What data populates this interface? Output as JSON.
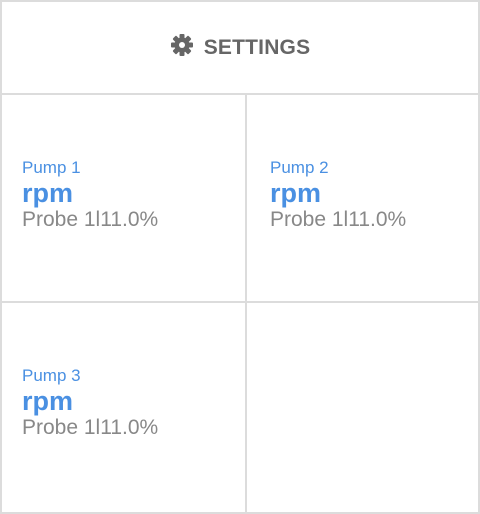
{
  "header": {
    "title": "SETTINGS",
    "icon": "gear-icon"
  },
  "colors": {
    "accent": "#4a90e2",
    "header_text": "#666666",
    "secondary_text": "#888888",
    "border": "#dcdcdc"
  },
  "pumps": [
    {
      "name": "Pump 1",
      "unit": "rpm",
      "probe": "Probe 1l11.0%"
    },
    {
      "name": "Pump 2",
      "unit": "rpm",
      "probe": "Probe 1l11.0%"
    },
    {
      "name": "Pump 3",
      "unit": "rpm",
      "probe": "Probe 1l11.0%"
    }
  ]
}
